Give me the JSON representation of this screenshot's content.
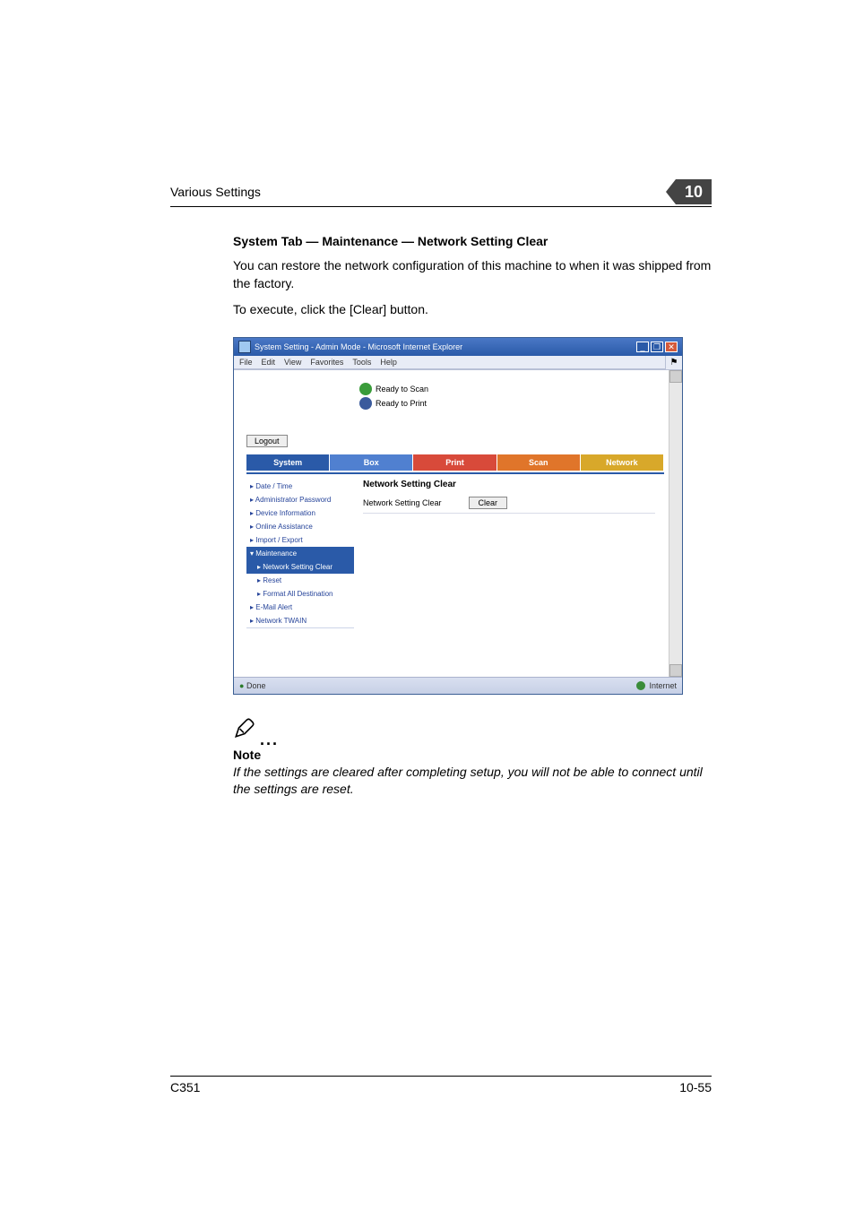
{
  "header": {
    "section": "Various Settings",
    "chapter": "10"
  },
  "section_title": "System Tab — Maintenance — Network Setting Clear",
  "paragraphs": {
    "p1": "You can restore the network configuration of this machine to when it was shipped from the factory.",
    "p2": "To execute, click the [Clear] button."
  },
  "ie": {
    "title": "System Setting - Admin Mode - Microsoft Internet Explorer",
    "menu": {
      "file": "File",
      "edit": "Edit",
      "view": "View",
      "favorites": "Favorites",
      "tools": "Tools",
      "help": "Help"
    },
    "status": {
      "scan": "Ready to Scan",
      "print": "Ready to Print"
    },
    "logout": "Logout",
    "tabs": {
      "system": "System",
      "box": "Box",
      "print": "Print",
      "scan": "Scan",
      "network": "Network"
    },
    "sidebar": {
      "datetime": "▸ Date / Time",
      "adminpw": "▸ Administrator Password",
      "devinfo": "▸ Device Information",
      "online": "▸ Online Assistance",
      "impexp": "▸ Import / Export",
      "maint": "▾ Maintenance",
      "netclr": "▸ Network Setting Clear",
      "reset": "▸ Reset",
      "fmtall": "▸ Format All Destination",
      "email": "▸ E-Mail Alert",
      "twain": "▸ Network TWAIN"
    },
    "panel": {
      "title": "Network Setting Clear",
      "row_label": "Network Setting Clear",
      "clear": "Clear"
    },
    "statusbar": {
      "done": "Done",
      "zone": "Internet"
    }
  },
  "note": {
    "label": "Note",
    "text": "If the settings are cleared after completing setup, you will not be able to connect until the settings are reset."
  },
  "footer": {
    "model": "C351",
    "page": "10-55"
  }
}
